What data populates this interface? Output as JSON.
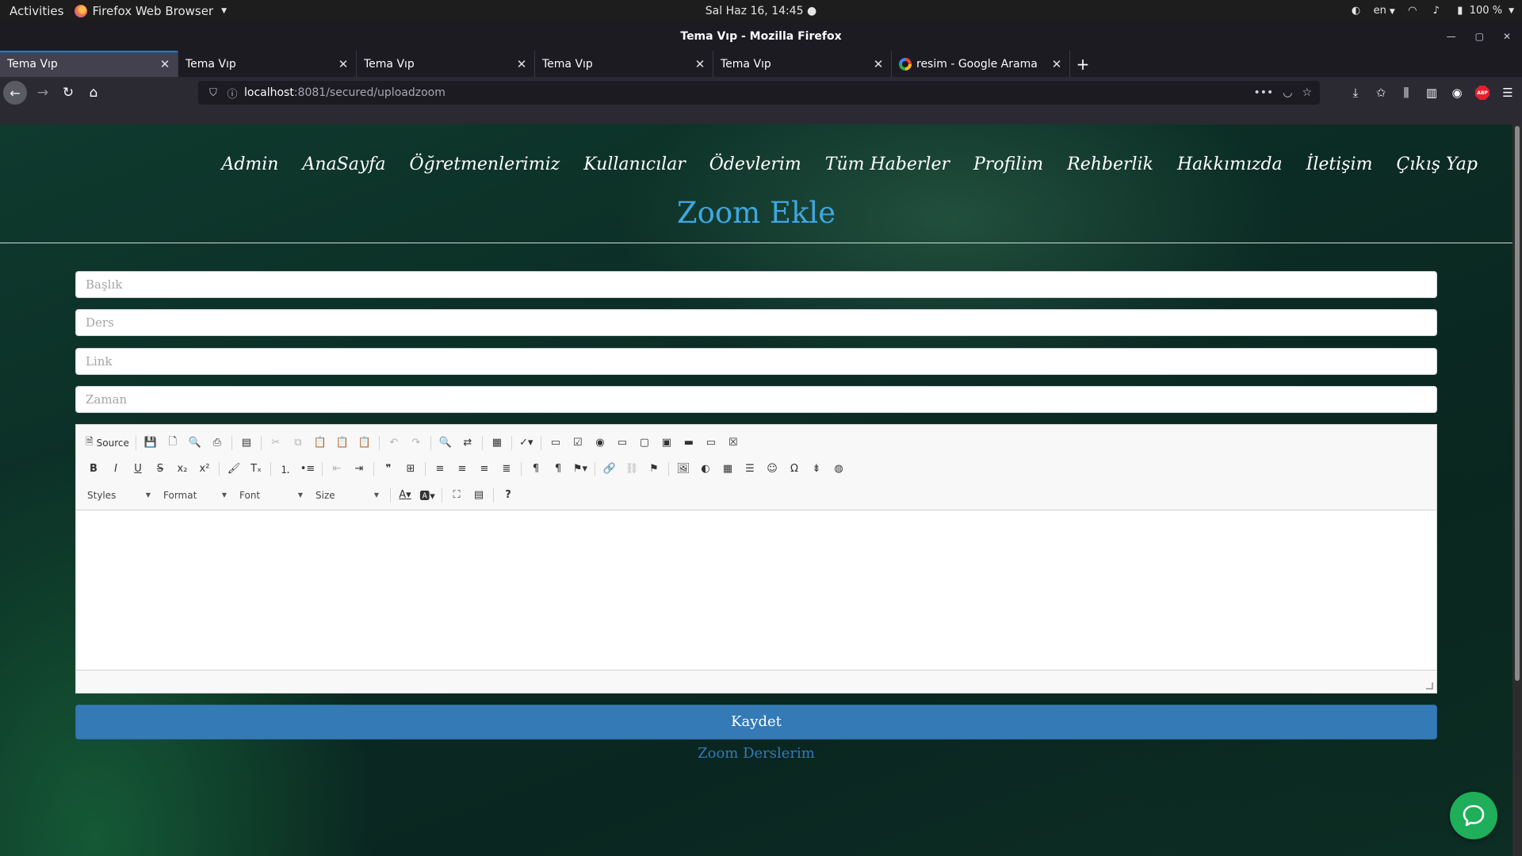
{
  "system_bar": {
    "activities": "Activities",
    "app_name": "Firefox Web Browser",
    "clock": "Sal Haz 16, 14:45",
    "language": "en",
    "battery": "100 %"
  },
  "window": {
    "title": "Tema Vıp - Mozilla Firefox"
  },
  "tabs": [
    {
      "label": "Tema Vıp"
    },
    {
      "label": "Tema Vıp"
    },
    {
      "label": "Tema Vıp"
    },
    {
      "label": "Tema Vıp"
    },
    {
      "label": "Tema Vıp"
    },
    {
      "label": "resim - Google Arama"
    }
  ],
  "url": {
    "host": "localhost",
    "path": ":8081/secured/uploadzoom"
  },
  "site_nav": {
    "items": [
      "Admin",
      "AnaSayfa",
      "Öğretmenlerimiz",
      "Kullanıcılar",
      "Ödevlerim",
      "Tüm Haberler",
      "Profilim",
      "Rehberlik",
      "Hakkımızda",
      "İletişim",
      "Çıkış Yap"
    ]
  },
  "page": {
    "title": "Zoom Ekle",
    "fields": {
      "baslik_placeholder": "Başlık",
      "ders_placeholder": "Ders",
      "link_placeholder": "Link",
      "zaman_placeholder": "Zaman"
    },
    "save_button": "Kaydet",
    "back_link": "Zoom Derslerim"
  },
  "editor": {
    "source_label": "Source",
    "combos": {
      "styles": "Styles",
      "format": "Format",
      "font": "Font",
      "size": "Size"
    }
  },
  "colors": {
    "accent_title": "#3ea7e0",
    "primary_button": "#337ab7",
    "chat_green": "#1fae5a",
    "tab_highlight": "#0a84ff"
  }
}
